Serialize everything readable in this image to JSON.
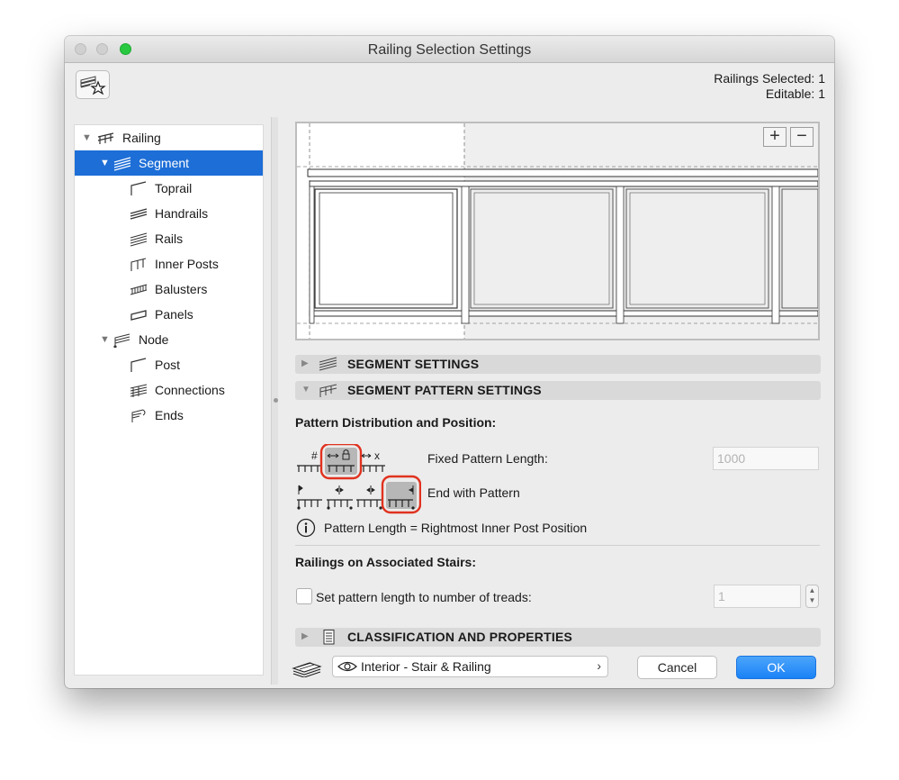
{
  "window": {
    "title": "Railing Selection Settings"
  },
  "header": {
    "favorites_icon": "favorites-star-icon",
    "railings_selected": "Railings Selected: 1",
    "editable": "Editable: 1"
  },
  "tree": {
    "items": [
      {
        "label": "Railing",
        "icon": "railing-icon",
        "expanded": true
      },
      {
        "label": "Segment",
        "icon": "segment-icon",
        "expanded": true,
        "selected": true
      },
      {
        "label": "Toprail",
        "icon": "toprail-icon"
      },
      {
        "label": "Handrails",
        "icon": "handrails-icon"
      },
      {
        "label": "Rails",
        "icon": "rails-icon"
      },
      {
        "label": "Inner Posts",
        "icon": "inner-posts-icon"
      },
      {
        "label": "Balusters",
        "icon": "balusters-icon"
      },
      {
        "label": "Panels",
        "icon": "panels-icon"
      },
      {
        "label": "Node",
        "icon": "node-icon",
        "expanded": true
      },
      {
        "label": "Post",
        "icon": "post-icon"
      },
      {
        "label": "Connections",
        "icon": "connections-icon"
      },
      {
        "label": "Ends",
        "icon": "ends-icon"
      }
    ]
  },
  "preview": {
    "zoom_in": "+",
    "zoom_out": "−"
  },
  "sections": {
    "segment_settings": "SEGMENT SETTINGS",
    "segment_pattern_settings": "SEGMENT PATTERN SETTINGS",
    "classification": "CLASSIFICATION AND PROPERTIES"
  },
  "pattern": {
    "heading": "Pattern Distribution and Position:",
    "fixed_length_label": "Fixed Pattern Length:",
    "fixed_length_value": "1000",
    "end_with_pattern_label": "End with Pattern",
    "info_text": "Pattern Length = Rightmost Inner Post Position",
    "icon_hash": "#",
    "icon_x": "x"
  },
  "stairs": {
    "heading": "Railings on Associated Stairs:",
    "checkbox_label": "Set pattern length to number of treads:",
    "treads_value": "1",
    "checked": false
  },
  "footer": {
    "classification_value": "Interior - Stair & Railing",
    "cancel_label": "Cancel",
    "ok_label": "OK"
  },
  "colors": {
    "selection": "#1d6ed7",
    "ok_button": "#1a82f6",
    "highlight_ring": "#e0321f"
  }
}
